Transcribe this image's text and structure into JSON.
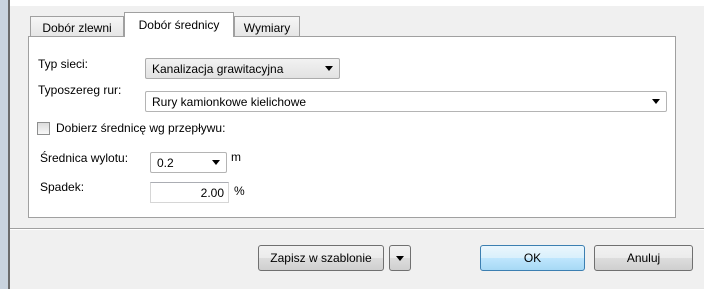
{
  "tabs": [
    {
      "label": "Dobór zlewni",
      "active": false
    },
    {
      "label": "Dobór średnicy",
      "active": true
    },
    {
      "label": "Wymiary",
      "active": false
    }
  ],
  "form": {
    "network_type": {
      "label": "Typ sieci:",
      "value": "Kanalizacja grawitacyjna"
    },
    "pipe_series": {
      "label": "Typoszereg rur:",
      "value": "Rury kamionkowe kielichowe"
    },
    "auto_diameter": {
      "label": "Dobierz średnicę wg przepływu:",
      "checked": false
    },
    "outlet_diameter": {
      "label": "Średnica wylotu:",
      "value": "0.2",
      "unit": "m"
    },
    "slope": {
      "label": "Spadek:",
      "value": "2.00",
      "unit": "%"
    }
  },
  "buttons": {
    "save_template": "Zapisz w szablonie",
    "ok": "OK",
    "cancel": "Anuluj"
  },
  "icons": {
    "dropdown": "chevron-down-icon"
  }
}
